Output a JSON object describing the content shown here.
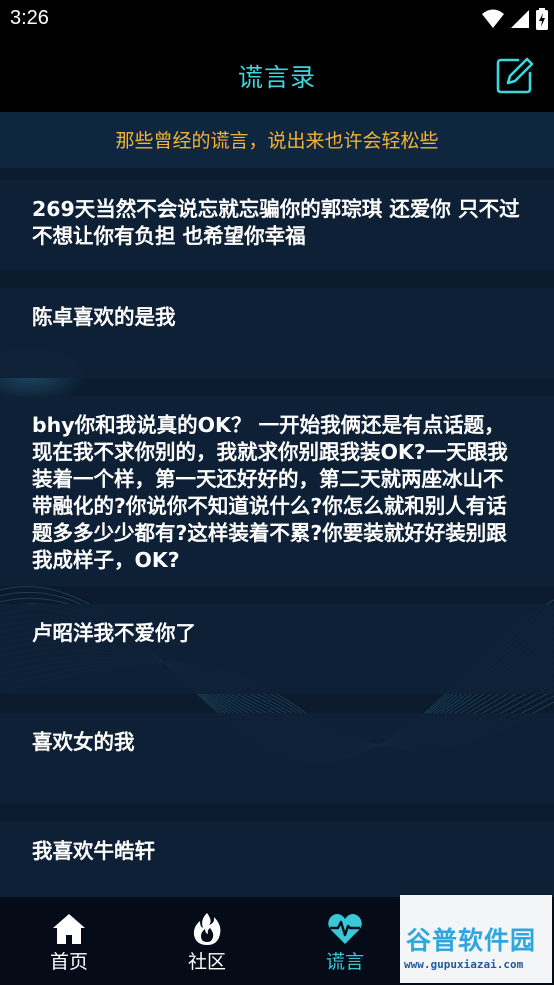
{
  "status_bar": {
    "time": "3:26",
    "icons": [
      "wifi-icon",
      "signal-icon",
      "battery-icon"
    ]
  },
  "header": {
    "title": "谎言录",
    "edit_icon": "edit-icon"
  },
  "subtitle": "那些曾经的谎言，说出来也许会轻松些",
  "lies": [
    {
      "text": "269天当然不会说忘就忘骗你的郭琮琪 还爱你 只不过不想让你有负担 也希望你幸福"
    },
    {
      "text": "陈卓喜欢的是我"
    },
    {
      "text": "bhy你和我说真的OK？ 一开始我俩还是有点话题，现在我不求你别的，我就求你别跟我装OK?一天跟我装着一个样，第一天还好好的，第二天就两座冰山不带融化的?你说你不知道说什么?你怎么就和别人有话题多多少少都有?这样装着不累?你要装就好好装别跟我成样子，OK?"
    },
    {
      "text": "卢昭洋我不爱你了"
    },
    {
      "text": "喜欢女的我"
    },
    {
      "text": "我喜欢牛皓轩"
    }
  ],
  "nav": {
    "items": [
      {
        "label": "首页",
        "icon": "home-icon"
      },
      {
        "label": "社区",
        "icon": "flame-icon"
      },
      {
        "label": "谎言",
        "icon": "heartbeat-icon",
        "active": true
      },
      {
        "label": "",
        "icon": "profile-icon"
      }
    ]
  },
  "watermark": {
    "title": "谷普软件园",
    "url": "www.gupuxiazai.com"
  },
  "colors": {
    "accent": "#3ad7dd",
    "subtitle": "#f2b233",
    "background": "#0b1a2c"
  }
}
